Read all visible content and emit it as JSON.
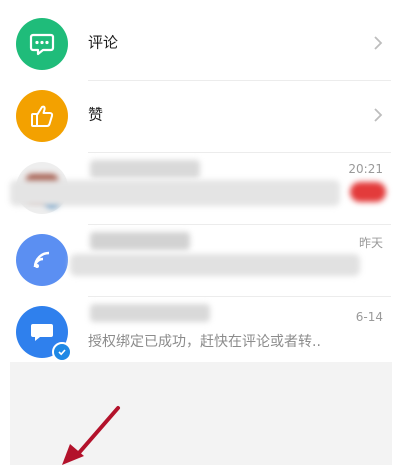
{
  "rows": {
    "comments": {
      "label": "评论",
      "color": "#1fbc7a"
    },
    "likes": {
      "label": "赞",
      "color": "#f3a100"
    },
    "conv1": {
      "time": "20:21"
    },
    "conv2": {
      "time": "昨天"
    },
    "conv3": {
      "time": "6-14",
      "preview": "授权绑定已成功，赶快在评论或者转.."
    }
  },
  "colors": {
    "accent": "#1e88e5",
    "chevron": "#bdbdbd",
    "arrow": "#b3122b"
  }
}
